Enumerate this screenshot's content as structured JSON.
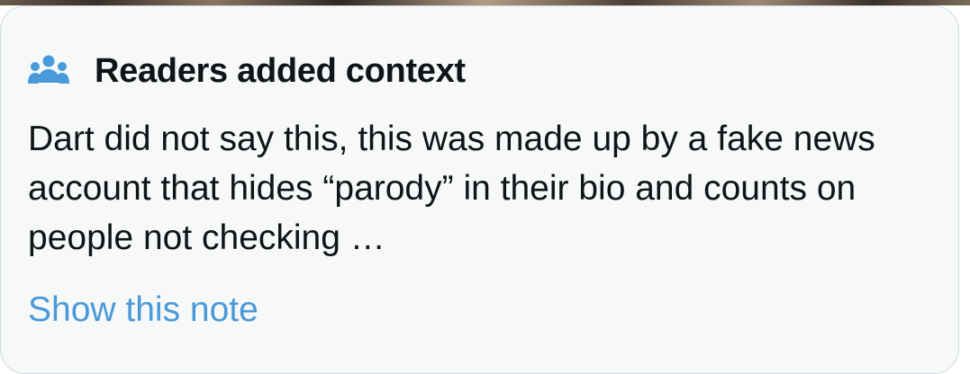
{
  "note": {
    "icon": "readers-group-icon",
    "title": "Readers added context",
    "body": "Dart did not say this, this was made up by a fake news account that hides “parody” in their bio and counts on people not checking …",
    "link_label": "Show this note"
  },
  "colors": {
    "card_background": "#f7f9f9",
    "card_border": "#cfd9de",
    "text": "#0f1419",
    "link": "#4a99d9",
    "icon": "#4a99d9"
  }
}
